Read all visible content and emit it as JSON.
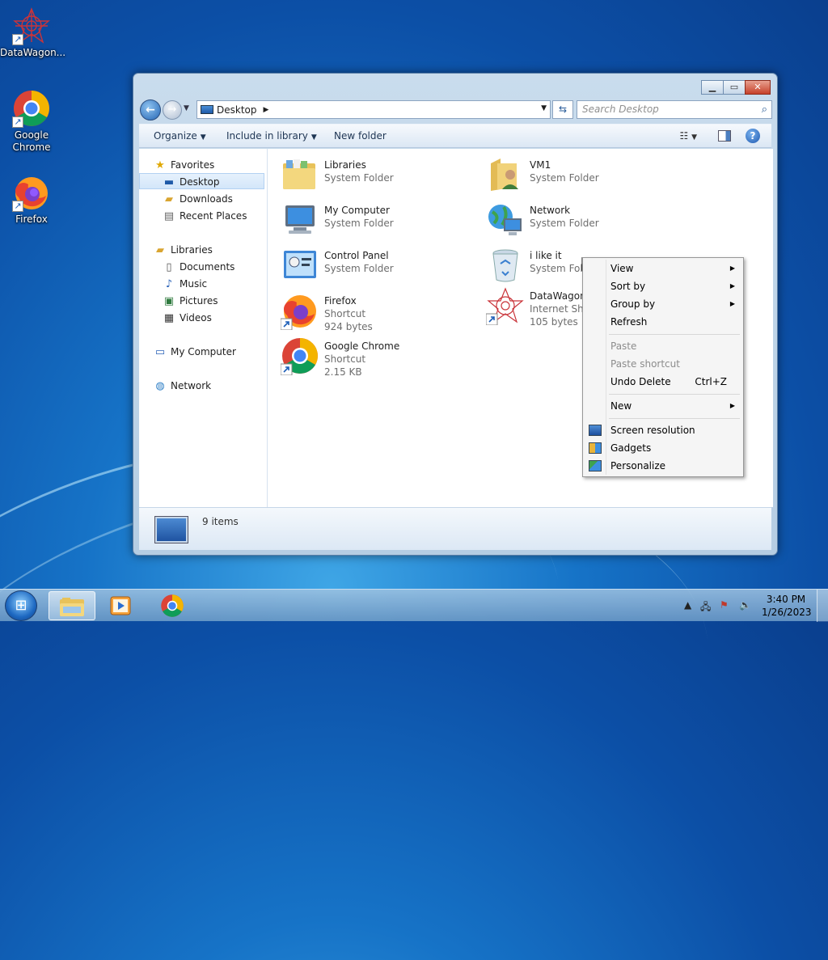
{
  "desktop": {
    "icons": [
      {
        "label": "DataWagon..."
      },
      {
        "label": "Google Chrome"
      },
      {
        "label": "Firefox"
      }
    ]
  },
  "window": {
    "address": "Desktop",
    "search_placeholder": "Search Desktop",
    "commands": {
      "organize": "Organize",
      "include_library": "Include in library",
      "new_folder": "New folder"
    },
    "nav": {
      "favorites": "Favorites",
      "desktop": "Desktop",
      "downloads": "Downloads",
      "recent_places": "Recent Places",
      "libraries": "Libraries",
      "documents": "Documents",
      "music": "Music",
      "pictures": "Pictures",
      "videos": "Videos",
      "my_computer": "My Computer",
      "network": "Network"
    },
    "items": [
      {
        "name": "Libraries",
        "type": "System Folder",
        "size": ""
      },
      {
        "name": "My Computer",
        "type": "System Folder",
        "size": ""
      },
      {
        "name": "Control Panel",
        "type": "System Folder",
        "size": ""
      },
      {
        "name": "Firefox",
        "type": "Shortcut",
        "size": "924 bytes"
      },
      {
        "name": "Google Chrome",
        "type": "Shortcut",
        "size": "2.15 KB"
      },
      {
        "name": "VM1",
        "type": "System Folder",
        "size": ""
      },
      {
        "name": "Network",
        "type": "System Folder",
        "size": ""
      },
      {
        "name": "i like it",
        "type": "System Folde",
        "size": ""
      },
      {
        "name": "DataWagon",
        "type": "Internet Sho",
        "size": "105 bytes"
      }
    ],
    "status": "9 items"
  },
  "context_menu": {
    "view": "View",
    "sort_by": "Sort by",
    "group_by": "Group by",
    "refresh": "Refresh",
    "paste": "Paste",
    "paste_shortcut": "Paste shortcut",
    "undo_delete": "Undo Delete",
    "undo_shortcut": "Ctrl+Z",
    "new": "New",
    "screen_resolution": "Screen resolution",
    "gadgets": "Gadgets",
    "personalize": "Personalize"
  },
  "taskbar": {
    "time": "3:40 PM",
    "date": "1/26/2023"
  },
  "colors": {
    "accent": "#1673c7",
    "selection": "#d3e6fa"
  }
}
